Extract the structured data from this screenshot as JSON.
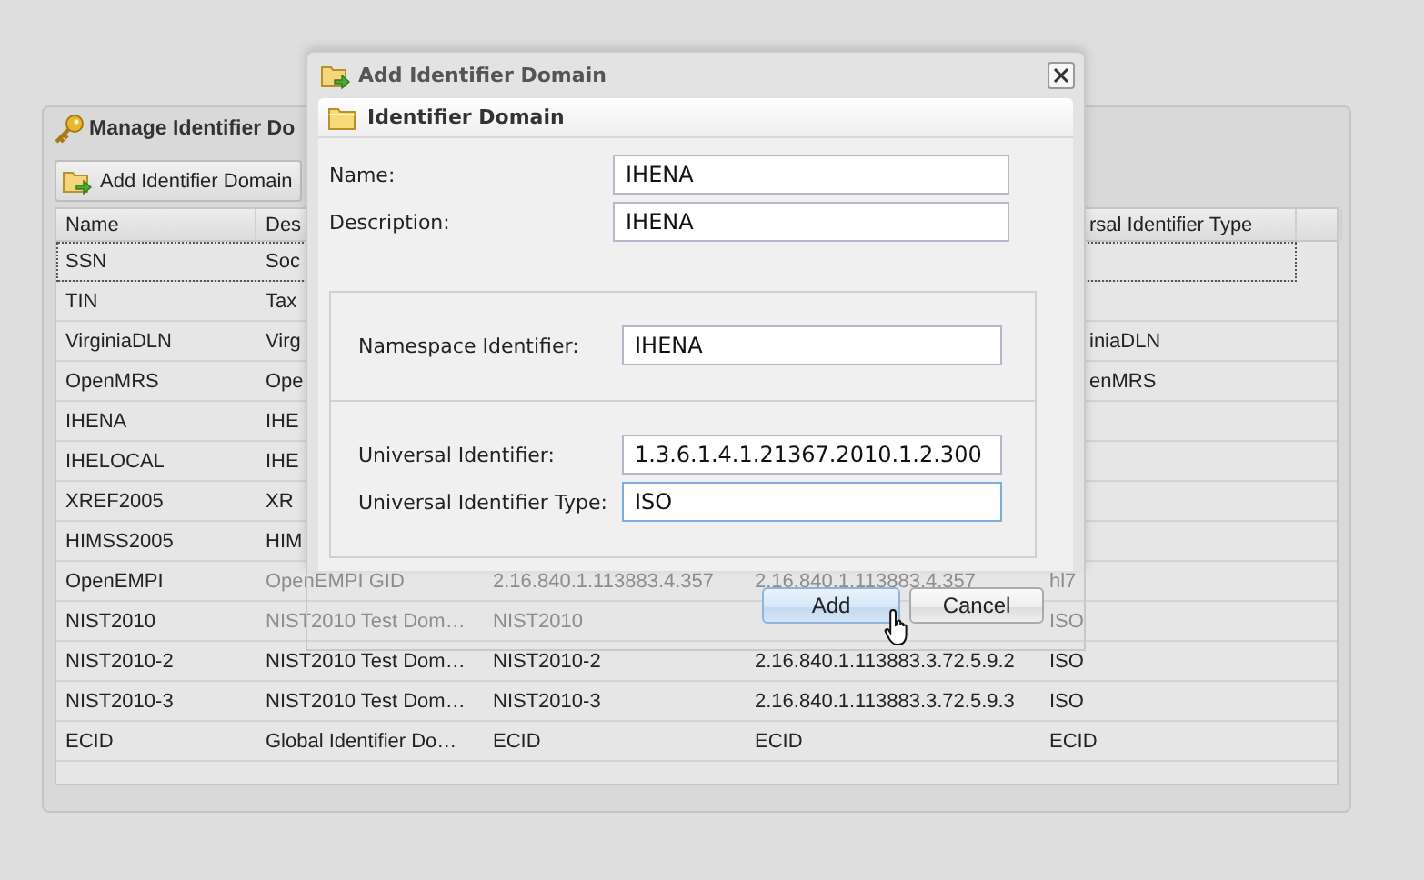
{
  "panel": {
    "title": "Manage Identifier Do",
    "toolbar": [
      {
        "label": "Add Identifier Domain"
      }
    ]
  },
  "table": {
    "columns": [
      {
        "label": "Name",
        "kind": "plain"
      },
      {
        "label": "Des",
        "kind": "plain"
      },
      null,
      null,
      {
        "label": "rsal Identifier Type",
        "kind": "cut_left"
      }
    ],
    "rows": [
      {
        "selected": true,
        "cells": [
          {
            "text": "SSN",
            "kind": "plain"
          },
          {
            "text": "Soc",
            "kind": "plain"
          },
          null,
          null,
          null
        ]
      },
      {
        "selected": false,
        "cells": [
          {
            "text": "TIN",
            "kind": "plain"
          },
          {
            "text": "Tax",
            "kind": "plain"
          },
          null,
          null,
          null
        ]
      },
      {
        "selected": false,
        "cells": [
          {
            "text": "VirginiaDLN",
            "kind": "plain"
          },
          {
            "text": "Virg",
            "kind": "plain"
          },
          null,
          null,
          {
            "text": "iniaDLN",
            "kind": "cut_left"
          }
        ]
      },
      {
        "selected": false,
        "cells": [
          {
            "text": "OpenMRS",
            "kind": "plain"
          },
          {
            "text": "Ope",
            "kind": "plain"
          },
          null,
          null,
          {
            "text": "enMRS",
            "kind": "cut_left"
          }
        ]
      },
      {
        "selected": false,
        "cells": [
          {
            "text": "IHENA",
            "kind": "plain"
          },
          {
            "text": "IHE",
            "kind": "plain"
          },
          null,
          null,
          null
        ]
      },
      {
        "selected": false,
        "cells": [
          {
            "text": "IHELOCAL",
            "kind": "plain"
          },
          {
            "text": "IHE",
            "kind": "plain"
          },
          null,
          null,
          null
        ]
      },
      {
        "selected": false,
        "cells": [
          {
            "text": "XREF2005",
            "kind": "plain"
          },
          {
            "text": "XR",
            "kind": "plain"
          },
          null,
          null,
          null
        ]
      },
      {
        "selected": false,
        "cells": [
          {
            "text": "HIMSS2005",
            "kind": "plain"
          },
          {
            "text": "HIM",
            "kind": "plain"
          },
          null,
          null,
          null
        ]
      },
      {
        "selected": false,
        "cells": [
          {
            "text": "OpenEMPI",
            "kind": "plain"
          },
          {
            "text": "OpenEMPI GID",
            "kind": "dim"
          },
          {
            "text": "2.16.840.1.113883.4.357",
            "kind": "dim"
          },
          {
            "text": "2.16.840.1.113883.4.357",
            "kind": "dim"
          },
          {
            "text": "hl7",
            "kind": "dim"
          }
        ]
      },
      {
        "selected": false,
        "cells": [
          {
            "text": "NIST2010",
            "kind": "plain"
          },
          {
            "text": "NIST2010 Test Dom…",
            "kind": "dim"
          },
          {
            "text": "NIST2010",
            "kind": "dim"
          },
          null,
          {
            "text": "ISO",
            "kind": "dim"
          }
        ]
      },
      {
        "selected": false,
        "cells": [
          {
            "text": "NIST2010-2",
            "kind": "plain"
          },
          {
            "text": "NIST2010 Test Dom…",
            "kind": "plain"
          },
          {
            "text": "NIST2010-2",
            "kind": "plain"
          },
          {
            "text": "2.16.840.1.113883.3.72.5.9.2",
            "kind": "plain"
          },
          {
            "text": "ISO",
            "kind": "plain"
          }
        ]
      },
      {
        "selected": false,
        "cells": [
          {
            "text": "NIST2010-3",
            "kind": "plain"
          },
          {
            "text": "NIST2010 Test Dom…",
            "kind": "plain"
          },
          {
            "text": "NIST2010-3",
            "kind": "plain"
          },
          {
            "text": "2.16.840.1.113883.3.72.5.9.3",
            "kind": "plain"
          },
          {
            "text": "ISO",
            "kind": "plain"
          }
        ]
      },
      {
        "selected": false,
        "cells": [
          {
            "text": "ECID",
            "kind": "plain"
          },
          {
            "text": "Global Identifier Do…",
            "kind": "plain"
          },
          {
            "text": "ECID",
            "kind": "plain"
          },
          {
            "text": "ECID",
            "kind": "plain"
          },
          {
            "text": "ECID",
            "kind": "plain"
          }
        ]
      }
    ]
  },
  "dialog": {
    "title": "Add Identifier Domain",
    "panel_title": "Identifier Domain",
    "fields": [
      {
        "label": "Name:",
        "value": "IHENA",
        "focused": false
      },
      {
        "label": "Description:",
        "value": "IHENA",
        "focused": false
      }
    ],
    "fieldsets": [
      {
        "fields": [
          {
            "label": "Namespace Identifier:",
            "value": "IHENA",
            "focused": false
          }
        ]
      },
      {
        "fields": [
          {
            "label": "Universal Identifier:",
            "value": "1.3.6.1.4.1.21367.2010.1.2.300",
            "focused": false
          },
          {
            "label": "Universal Identifier Type:",
            "value": "ISO",
            "focused": true
          }
        ]
      }
    ],
    "buttons": [
      {
        "label": "Add",
        "hovered": true
      },
      {
        "label": "Cancel",
        "hovered": false
      }
    ]
  }
}
